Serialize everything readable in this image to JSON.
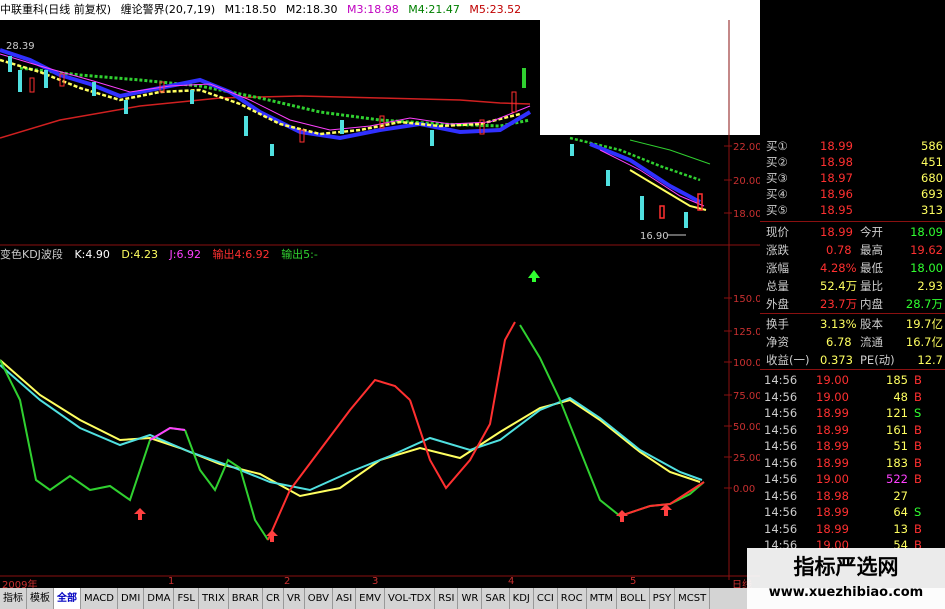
{
  "header": {
    "title": "中联重科(日线 前复权)",
    "indicator": "缠论警界(20,7,19)",
    "ma": [
      {
        "label": "M1:18.50",
        "color": "#000000"
      },
      {
        "label": "M2:18.30",
        "color": "#000000"
      },
      {
        "label": "M3:18.98",
        "color": "#c000c0"
      },
      {
        "label": "M4:21.47",
        "color": "#008000"
      },
      {
        "label": "M5:23.52",
        "color": "#c00000"
      }
    ]
  },
  "price_axis": {
    "ticks": [
      "22.00",
      "20.00",
      "18.00"
    ],
    "labels": [
      "28.39",
      "16.90"
    ]
  },
  "indicator": {
    "name": "变色KDJ波段",
    "k": "K:4.90",
    "d": "D:4.23",
    "j": "J:6.92",
    "out4": "输出4:6.92",
    "out5": "输出5:-",
    "ticks": [
      "150.00",
      "125.00",
      "100.00",
      "75.00",
      "50.00",
      "25.00",
      "0.00"
    ]
  },
  "bottom_axis": {
    "labels": [
      "2009年",
      "1",
      "2",
      "3",
      "4",
      "5",
      "日线"
    ]
  },
  "quote": {
    "sells_top": [
      {
        "label": "买①",
        "price": "18.99",
        "vol": "586"
      }
    ],
    "buys": [
      {
        "label": "买②",
        "price": "18.98",
        "vol": "451"
      },
      {
        "label": "买③",
        "price": "18.97",
        "vol": "680"
      },
      {
        "label": "买④",
        "price": "18.96",
        "vol": "693"
      },
      {
        "label": "买⑤",
        "price": "18.95",
        "vol": "313"
      }
    ],
    "stats": [
      {
        "l1": "现价",
        "v1": "18.99",
        "l2": "今开",
        "v2": "18.09"
      },
      {
        "l1": "涨跌",
        "v1": "0.78",
        "l2": "最高",
        "v2": "19.62"
      },
      {
        "l1": "涨幅",
        "v1": "4.28%",
        "l2": "最低",
        "v2": "18.00"
      },
      {
        "l1": "总量",
        "v1": "52.4万",
        "l2": "量比",
        "v2": "2.93"
      },
      {
        "l1": "外盘",
        "v1": "23.7万",
        "l2": "内盘",
        "v2": "28.7万"
      },
      {
        "l1": "换手",
        "v1": "3.13%",
        "l2": "股本",
        "v2": "19.7亿"
      },
      {
        "l1": "净资",
        "v1": "6.78",
        "l2": "流通",
        "v2": "16.7亿"
      },
      {
        "l1": "收益(一)",
        "v1": "0.373",
        "l2": "PE(动)",
        "v2": "12.7"
      }
    ],
    "ticks": [
      {
        "t": "14:56",
        "p": "19.00",
        "v": "185",
        "s": "B"
      },
      {
        "t": "14:56",
        "p": "19.00",
        "v": "48",
        "s": "B"
      },
      {
        "t": "14:56",
        "p": "18.99",
        "v": "121",
        "s": "S"
      },
      {
        "t": "14:56",
        "p": "18.99",
        "v": "161",
        "s": "B"
      },
      {
        "t": "14:56",
        "p": "18.99",
        "v": "51",
        "s": "B"
      },
      {
        "t": "14:56",
        "p": "18.99",
        "v": "183",
        "s": "B"
      },
      {
        "t": "14:56",
        "p": "19.00",
        "v": "522",
        "s": "B"
      },
      {
        "t": "14:56",
        "p": "18.98",
        "v": "27",
        "s": ""
      },
      {
        "t": "14:56",
        "p": "18.99",
        "v": "64",
        "s": "S"
      },
      {
        "t": "14:56",
        "p": "18.99",
        "v": "13",
        "s": "B"
      },
      {
        "t": "14:56",
        "p": "19.00",
        "v": "54",
        "s": "B"
      }
    ]
  },
  "tabs": [
    "指标",
    "模板",
    "全部",
    "MACD",
    "DMI",
    "DMA",
    "FSL",
    "TRIX",
    "BRAR",
    "CR",
    "VR",
    "OBV",
    "ASI",
    "EMV",
    "VOL-TDX",
    "RSI",
    "WR",
    "SAR",
    "KDJ",
    "CCI",
    "ROC",
    "MTM",
    "BOLL",
    "PSY",
    "MCST"
  ],
  "watermark": {
    "cn": "指标严选网",
    "url": "www.xuezhibiao.com"
  },
  "colors": {
    "up": "#ff3030",
    "down": "#50e0e0",
    "yellow": "#ffff60",
    "green": "#30ff30",
    "magenta": "#ff40ff"
  }
}
